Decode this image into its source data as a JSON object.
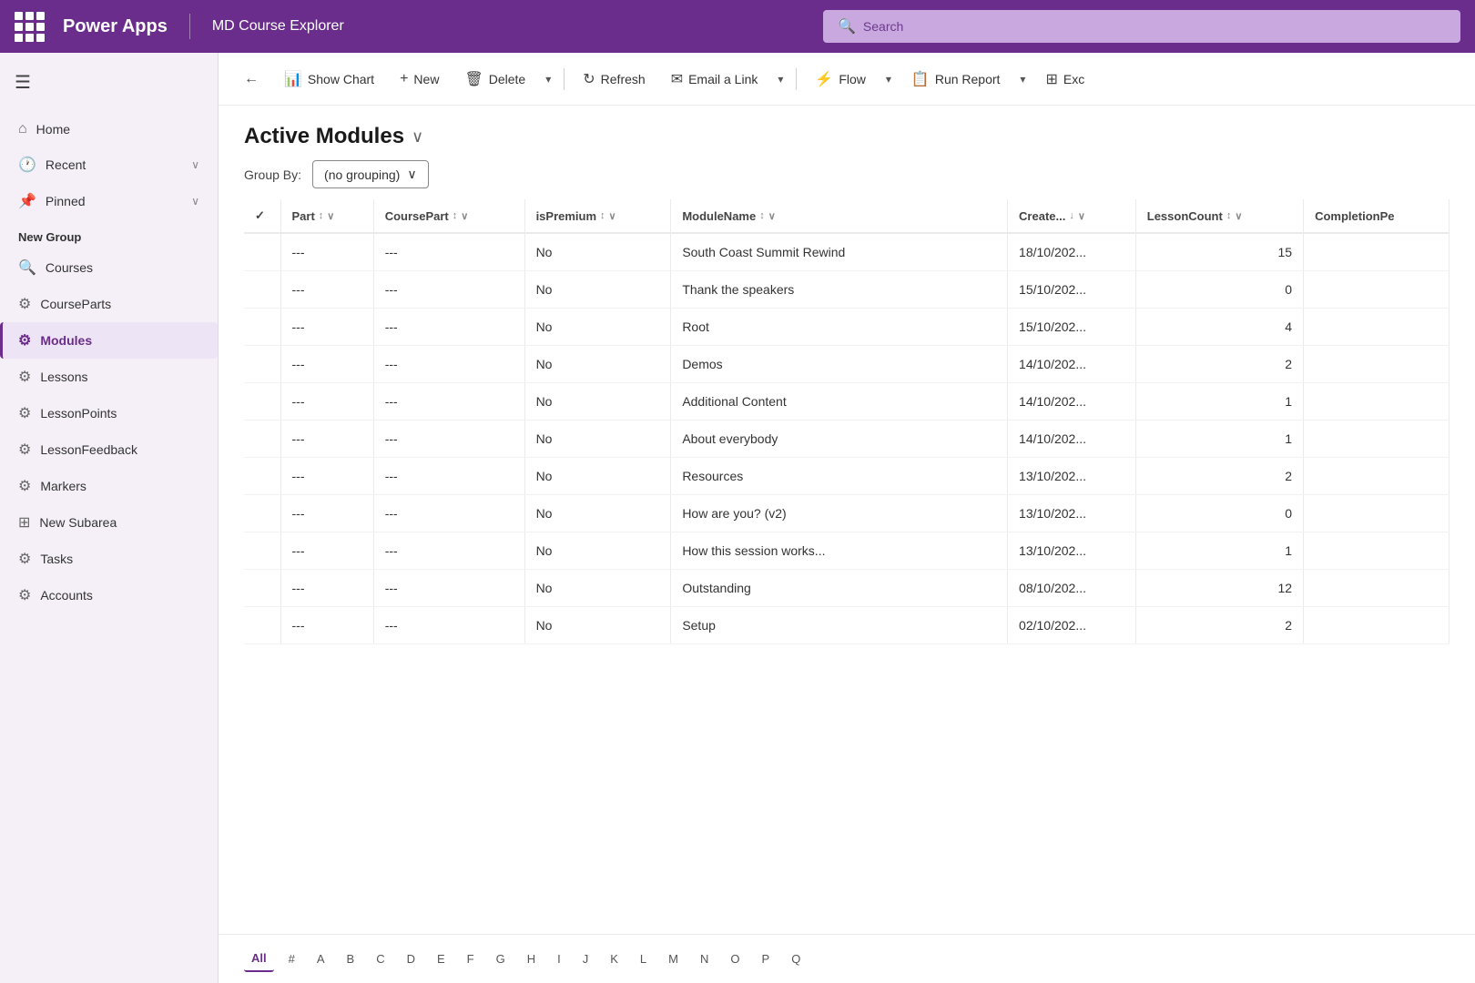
{
  "topbar": {
    "brand": "Power Apps",
    "appname": "MD Course Explorer",
    "search_placeholder": "Search"
  },
  "sidebar": {
    "menu_icon": "☰",
    "nav": [
      {
        "id": "home",
        "label": "Home",
        "icon": "⌂"
      },
      {
        "id": "recent",
        "label": "Recent",
        "icon": "🕐",
        "chevron": "∨"
      },
      {
        "id": "pinned",
        "label": "Pinned",
        "icon": "📌",
        "chevron": "∨"
      }
    ],
    "section_label": "New Group",
    "items": [
      {
        "id": "courses",
        "label": "Courses",
        "icon": "🔍"
      },
      {
        "id": "courseparts",
        "label": "CourseParts",
        "icon": "⚙"
      },
      {
        "id": "modules",
        "label": "Modules",
        "icon": "⚙",
        "active": true
      },
      {
        "id": "lessons",
        "label": "Lessons",
        "icon": "⚙"
      },
      {
        "id": "lessonpoints",
        "label": "LessonPoints",
        "icon": "⚙"
      },
      {
        "id": "lessonfeedback",
        "label": "LessonFeedback",
        "icon": "⚙"
      },
      {
        "id": "markers",
        "label": "Markers",
        "icon": "⚙"
      },
      {
        "id": "newsubarea",
        "label": "New Subarea",
        "icon": "⊞"
      },
      {
        "id": "tasks",
        "label": "Tasks",
        "icon": "⚙"
      },
      {
        "id": "accounts",
        "label": "Accounts",
        "icon": "⚙"
      }
    ]
  },
  "commandbar": {
    "back_label": "←",
    "show_chart_label": "Show Chart",
    "new_label": "New",
    "delete_label": "Delete",
    "refresh_label": "Refresh",
    "email_link_label": "Email a Link",
    "flow_label": "Flow",
    "run_report_label": "Run Report",
    "excel_label": "Exc"
  },
  "page": {
    "title": "Active Modules",
    "groupby_label": "Group By:",
    "groupby_value": "(no grouping)"
  },
  "table": {
    "columns": [
      {
        "id": "check",
        "label": "✓",
        "sortable": false
      },
      {
        "id": "part",
        "label": "Part",
        "sortable": true
      },
      {
        "id": "coursepart",
        "label": "CoursePart",
        "sortable": true
      },
      {
        "id": "ispremium",
        "label": "isPremium",
        "sortable": true
      },
      {
        "id": "modulename",
        "label": "ModuleName",
        "sortable": true
      },
      {
        "id": "created",
        "label": "Create...",
        "sortable": true,
        "sorted": true
      },
      {
        "id": "lessoncount",
        "label": "LessonCount",
        "sortable": true
      },
      {
        "id": "completionpe",
        "label": "CompletionPe",
        "sortable": false
      }
    ],
    "rows": [
      {
        "part": "---",
        "coursepart": "---",
        "ispremium": "No",
        "modulename": "South Coast Summit Rewind",
        "created": "18/10/202...",
        "lessoncount": "15",
        "completionpe": ""
      },
      {
        "part": "---",
        "coursepart": "---",
        "ispremium": "No",
        "modulename": "Thank the speakers",
        "created": "15/10/202...",
        "lessoncount": "0",
        "completionpe": ""
      },
      {
        "part": "---",
        "coursepart": "---",
        "ispremium": "No",
        "modulename": "Root",
        "created": "15/10/202...",
        "lessoncount": "4",
        "completionpe": ""
      },
      {
        "part": "---",
        "coursepart": "---",
        "ispremium": "No",
        "modulename": "Demos",
        "created": "14/10/202...",
        "lessoncount": "2",
        "completionpe": ""
      },
      {
        "part": "---",
        "coursepart": "---",
        "ispremium": "No",
        "modulename": "Additional Content",
        "created": "14/10/202...",
        "lessoncount": "1",
        "completionpe": ""
      },
      {
        "part": "---",
        "coursepart": "---",
        "ispremium": "No",
        "modulename": "About everybody",
        "created": "14/10/202...",
        "lessoncount": "1",
        "completionpe": ""
      },
      {
        "part": "---",
        "coursepart": "---",
        "ispremium": "No",
        "modulename": "Resources",
        "created": "13/10/202...",
        "lessoncount": "2",
        "completionpe": ""
      },
      {
        "part": "---",
        "coursepart": "---",
        "ispremium": "No",
        "modulename": "How are you? (v2)",
        "created": "13/10/202...",
        "lessoncount": "0",
        "completionpe": ""
      },
      {
        "part": "---",
        "coursepart": "---",
        "ispremium": "No",
        "modulename": "How this session works...",
        "created": "13/10/202...",
        "lessoncount": "1",
        "completionpe": ""
      },
      {
        "part": "---",
        "coursepart": "---",
        "ispremium": "No",
        "modulename": "Outstanding",
        "created": "08/10/202...",
        "lessoncount": "12",
        "completionpe": ""
      },
      {
        "part": "---",
        "coursepart": "---",
        "ispremium": "No",
        "modulename": "Setup",
        "created": "02/10/202...",
        "lessoncount": "2",
        "completionpe": ""
      }
    ]
  },
  "pagination": {
    "active": "All",
    "letters": [
      "All",
      "#",
      "A",
      "B",
      "C",
      "D",
      "E",
      "F",
      "G",
      "H",
      "I",
      "J",
      "K",
      "L",
      "M",
      "N",
      "O",
      "P",
      "Q"
    ]
  }
}
